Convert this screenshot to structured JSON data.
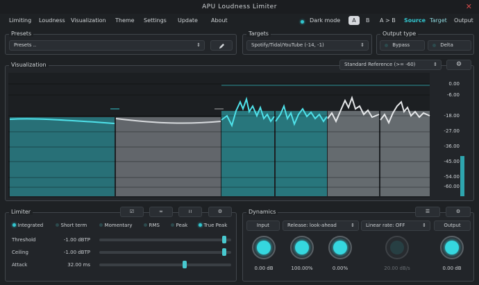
{
  "app": {
    "title": "APU Loudness Limiter",
    "close_glyph": "✕"
  },
  "menu": {
    "items": [
      "Limiting",
      "Loudness",
      "Visualization",
      "Theme",
      "Settings",
      "Update",
      "About"
    ],
    "dark_mode_label": "Dark mode",
    "ab": {
      "a": "A",
      "b": "B",
      "a_to_b": "A > B"
    },
    "routing": {
      "source": "Source",
      "target": "Target",
      "output": "Output"
    }
  },
  "presets": {
    "title": "Presets",
    "value": "Presets ..",
    "arrows": "⇕",
    "edit_icon": "pencil-icon"
  },
  "targets": {
    "title": "Targets",
    "value": "Spotify/Tidal/YouTube (-14, -1)",
    "arrows": "⇕"
  },
  "output_type": {
    "title": "Output type",
    "bypass": "Bypass",
    "delta": "Delta"
  },
  "visualization": {
    "title": "Visualization",
    "reference": "Standard Reference (>= -60)",
    "arrows": "⇕",
    "scale": [
      "0.00",
      "-6.00",
      "-18.00",
      "-27.00",
      "-36.00",
      "-45.00",
      "-54.00",
      "-60.00"
    ]
  },
  "limiter": {
    "title": "Limiter",
    "modes": [
      {
        "label": "Integrated",
        "on": true
      },
      {
        "label": "Short term",
        "on": false
      },
      {
        "label": "Momentary",
        "on": false
      },
      {
        "label": "RMS",
        "on": false
      },
      {
        "label": "Peak",
        "on": false
      },
      {
        "label": "True Peak",
        "on": true
      }
    ],
    "params": [
      {
        "label": "Threshold",
        "value": "-1.00 dBTP",
        "level": 0.96
      },
      {
        "label": "Ceiling",
        "value": "-1.00 dBTP",
        "level": 0.96
      },
      {
        "label": "Attack",
        "value": "32.00 ms",
        "level": 0.65
      }
    ],
    "toolbar_icons": [
      "checkbox-icon",
      "infinity-icon",
      "waveform-icon",
      "gear-icon"
    ]
  },
  "dynamics": {
    "title": "Dynamics",
    "input": "Input",
    "release": "Release: look-ahead",
    "linear_rate": "Linear rate: OFF",
    "output": "Output",
    "arrows": "⇕",
    "knobs": [
      {
        "value": "0.00 dB",
        "enabled": true
      },
      {
        "value": "100.00%",
        "enabled": true
      },
      {
        "value": "0.00%",
        "enabled": true
      },
      {
        "value": "20.00 dB/s",
        "enabled": false
      },
      {
        "value": "0.00 dB",
        "enabled": true
      }
    ]
  },
  "colors": {
    "accent": "#32c6cf",
    "bar_teal": "#2a7f86",
    "bar_gray": "#6e7378",
    "background": "#1e2124"
  }
}
